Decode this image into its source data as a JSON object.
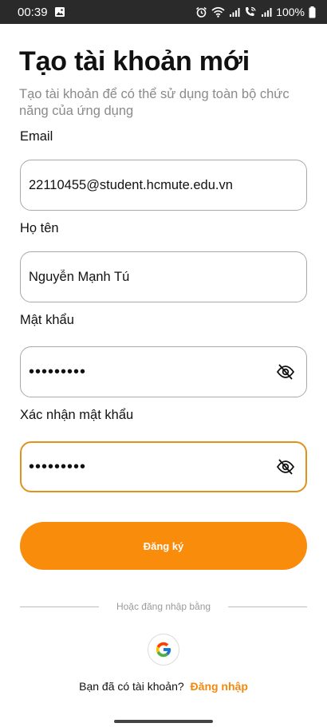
{
  "status_bar": {
    "time": "00:39",
    "battery": "100%"
  },
  "header": {
    "title": "Tạo tài khoản mới",
    "subtitle": "Tạo tài khoản để có thể sử dụng toàn bộ chức năng của ứng dụng"
  },
  "form": {
    "email": {
      "label": "Email",
      "value": "22110455@student.hcmute.edu.vn"
    },
    "fullname": {
      "label": "Họ tên",
      "value": "Nguyễn Mạnh Tú"
    },
    "password": {
      "label": "Mật khẩu",
      "value": "•••••••••",
      "icon": "eye-off-icon"
    },
    "confirm_password": {
      "label": "Xác nhận mật khẩu",
      "value": "•••••••••",
      "icon": "eye-off-icon",
      "focused": true
    }
  },
  "register_button": {
    "label": "Đăng ký"
  },
  "divider": {
    "text": "Hoặc đăng nhập bằng"
  },
  "google": {
    "icon": "google-icon"
  },
  "signin": {
    "prompt": "Bạn đã có tài khoản?",
    "link": "Đăng nhập"
  },
  "colors": {
    "accent": "#fa8c0b",
    "focus_border": "#e2921b",
    "link": "#f08a0e"
  }
}
